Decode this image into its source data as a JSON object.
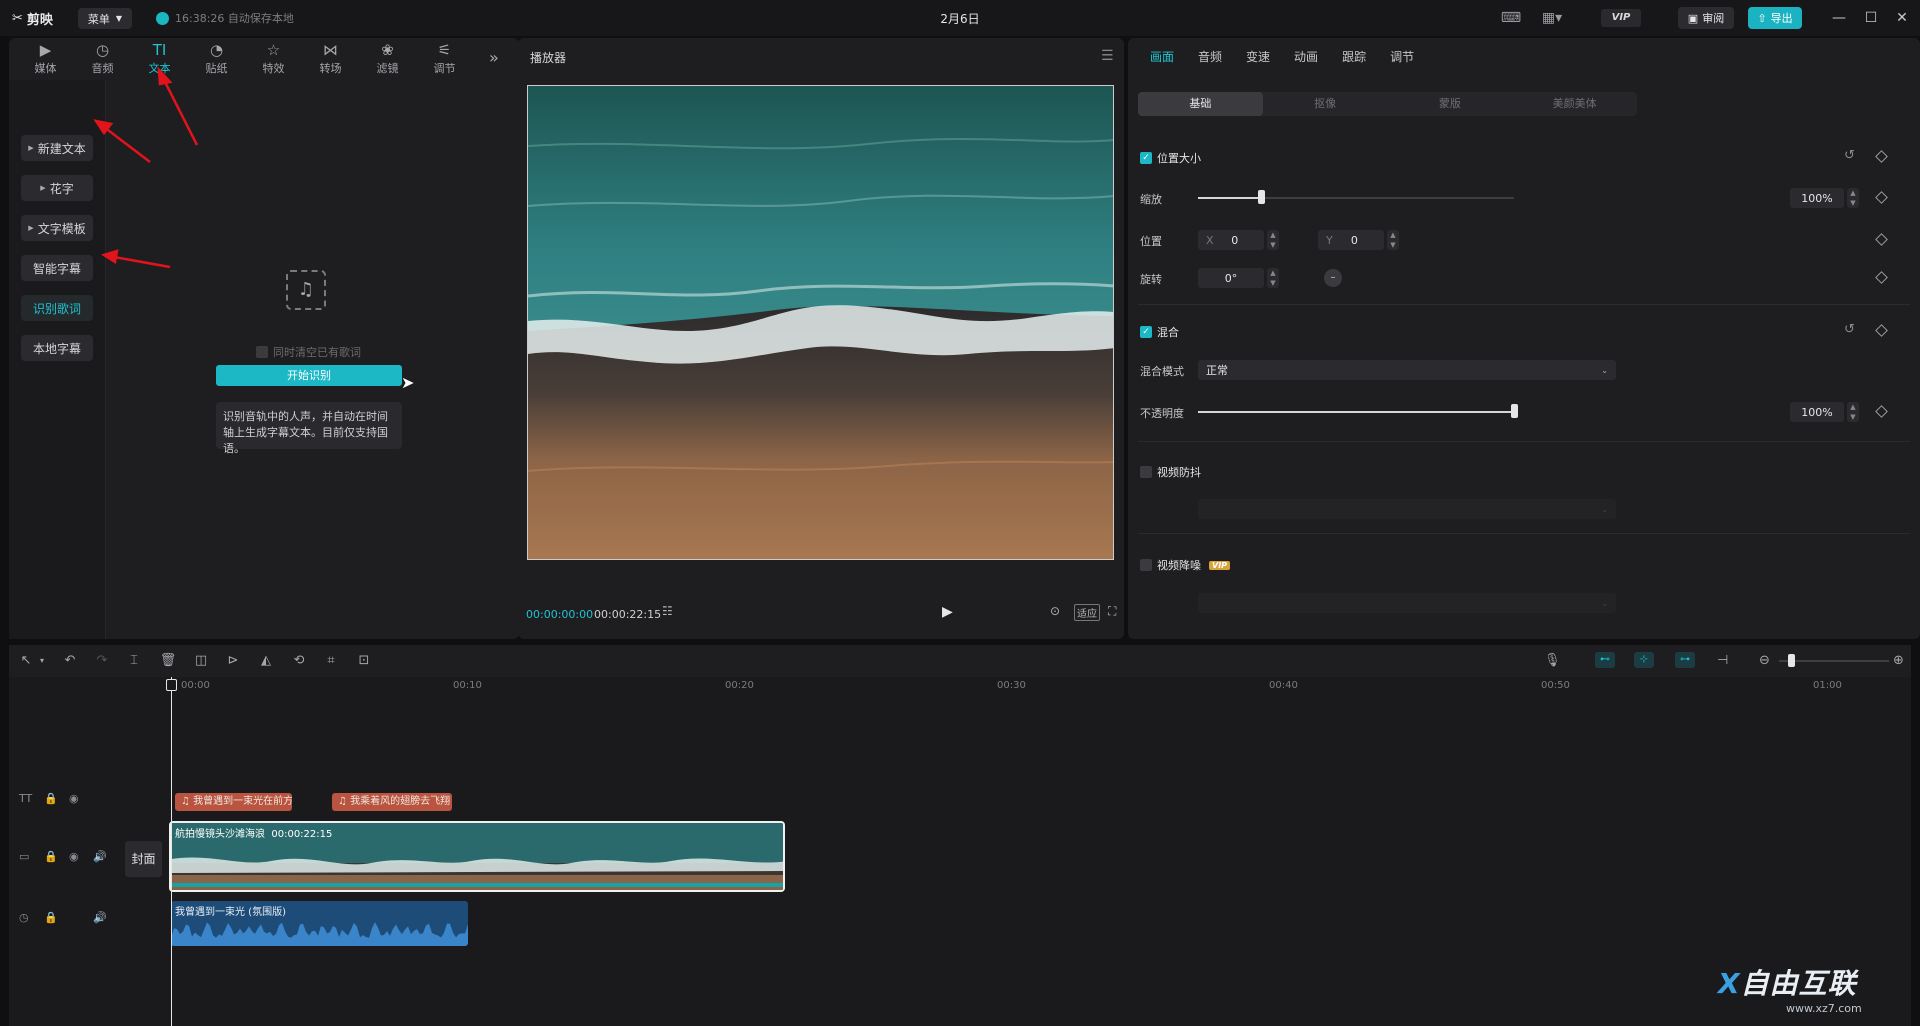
{
  "app": {
    "name": "剪映",
    "menu_label": "菜单",
    "autosave": "16:38:26 自动保存本地",
    "title": "2月6日",
    "vip": "VIP",
    "review": "审阅",
    "export": "导出"
  },
  "left_tabs": [
    {
      "label": "媒体",
      "icon": "media-icon"
    },
    {
      "label": "音频",
      "icon": "audio-icon"
    },
    {
      "label": "文本",
      "icon": "text-icon"
    },
    {
      "label": "贴纸",
      "icon": "sticker-icon"
    },
    {
      "label": "特效",
      "icon": "effects-icon"
    },
    {
      "label": "转场",
      "icon": "transition-icon"
    },
    {
      "label": "滤镜",
      "icon": "filter-icon"
    },
    {
      "label": "调节",
      "icon": "adjust-icon"
    }
  ],
  "text_sidebar": [
    "新建文本",
    "花字",
    "文字模板",
    "智能字幕",
    "识别歌词",
    "本地字幕"
  ],
  "lyric": {
    "checkbox": "同时清空已有歌词",
    "start_button": "开始识别",
    "info": "识别音轨中的人声，并自动在时间轴上生成字幕文本。目前仅支持国语。"
  },
  "player": {
    "title": "播放器",
    "current_time": "00:00:00:00",
    "total_time": "00:00:22:15",
    "fit_label": "适应"
  },
  "props": {
    "tabs": [
      "画面",
      "音频",
      "变速",
      "动画",
      "跟踪",
      "调节"
    ],
    "subtabs": [
      "基础",
      "抠像",
      "蒙版",
      "美颜美体"
    ],
    "position_size": {
      "title": "位置大小",
      "scale_label": "缩放",
      "scale_value": "100%",
      "scale": 0.2,
      "position_label": "位置",
      "x_label": "X",
      "x_value": "0",
      "y_label": "Y",
      "y_value": "0",
      "rotate_label": "旋转",
      "rotate_value": "0°"
    },
    "blend": {
      "title": "混合",
      "mode_label": "混合模式",
      "mode_value": "正常",
      "opacity_label": "不透明度",
      "opacity_value": "100%",
      "opacity": 1.0
    },
    "stabilize": {
      "title": "视频防抖"
    },
    "denoise": {
      "title": "视频降噪",
      "badge": "VIP"
    }
  },
  "timeline": {
    "ticks": [
      "00:00",
      "00:10",
      "00:20",
      "00:30",
      "00:40",
      "00:50",
      "01:00"
    ],
    "cover_label": "封面",
    "text_clips": [
      "我曾遇到一束光在前方",
      "我乘着风的翅膀去飞翔"
    ],
    "video_clip": {
      "name": "航拍慢镜头沙滩海浪",
      "duration": "00:00:22:15"
    },
    "audio_clip": {
      "name": "我曾遇到一束光 (氛围版)"
    }
  },
  "watermark": {
    "text": "自由互联",
    "url": "www.xz7.com"
  }
}
